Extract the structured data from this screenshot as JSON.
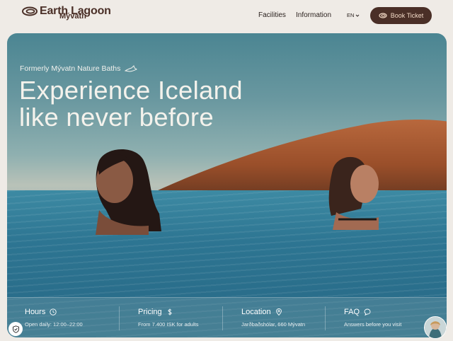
{
  "brand": {
    "name": "Earth Lagoon",
    "location": "Mývatn"
  },
  "nav": {
    "items": [
      "Facilities",
      "Information"
    ],
    "language": "EN",
    "book_label": "Book Ticket"
  },
  "hero": {
    "eyebrow": "Formerly Mývatn Nature Baths",
    "headline_line1": "Experience Iceland",
    "headline_line2": "like never before"
  },
  "info": [
    {
      "title": "Hours",
      "icon": "clock-icon",
      "sub": "Open daily: 12:00–22:00"
    },
    {
      "title": "Pricing",
      "icon": "dollar-icon",
      "sub": "From 7.400 ISK for adults"
    },
    {
      "title": "Location",
      "icon": "location-pin-icon",
      "sub": "Jarðbaðshólar, 660 Mývatn"
    },
    {
      "title": "FAQ",
      "icon": "chat-bubble-icon",
      "sub": "Answers before you visit"
    }
  ],
  "colors": {
    "brand_brown": "#4a2f27",
    "button_text": "#f1d9c6",
    "page_bg": "#efebe6"
  }
}
